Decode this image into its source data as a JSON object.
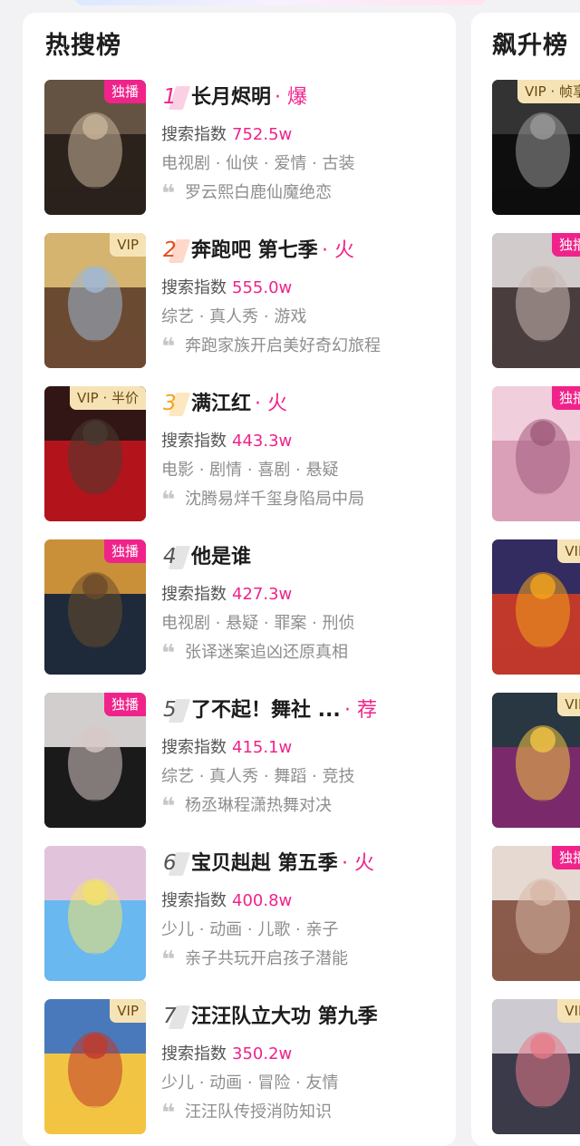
{
  "hot_list": {
    "title": "热搜榜",
    "index_label": "搜索指数",
    "items": [
      {
        "rank": "1",
        "title": "长月烬明",
        "tag": "· 爆",
        "index": "752.5w",
        "genres": "电视剧 · 仙侠 · 爱情 · 古装",
        "quote": "罗云熙白鹿仙魔绝恋",
        "badge": "独播",
        "badge_type": "exclusive",
        "poster_colors": [
          "#6e5a4a",
          "#2b221c",
          "#c8b49a"
        ]
      },
      {
        "rank": "2",
        "title": "奔跑吧 第七季",
        "tag": "· 火",
        "index": "555.0w",
        "genres": "综艺 · 真人秀 · 游戏",
        "quote": "奔跑家族开启美好奇幻旅程",
        "badge": "VIP",
        "badge_type": "vip",
        "poster_colors": [
          "#e8c77a",
          "#6b4a32",
          "#9fb8d4"
        ]
      },
      {
        "rank": "3",
        "title": "满江红",
        "tag": "· 火",
        "index": "443.3w",
        "genres": "电影 · 剧情 · 喜剧 · 悬疑",
        "quote": "沈腾易烊千玺身陷局中局",
        "badge": "VIP · 半价",
        "badge_type": "vip",
        "poster_colors": [
          "#1a1614",
          "#b3141c",
          "#4a3a30"
        ]
      },
      {
        "rank": "4",
        "title": "他是谁",
        "tag": "",
        "index": "427.3w",
        "genres": "电视剧 · 悬疑 · 罪案 · 刑侦",
        "quote": "张译迷案追凶还原真相",
        "badge": "独播",
        "badge_type": "exclusive",
        "poster_colors": [
          "#e8a23a",
          "#1e2a3a",
          "#6a4a2a"
        ]
      },
      {
        "rank": "5",
        "title": "了不起！舞社 ...",
        "tag": "· 荐",
        "index": "415.1w",
        "genres": "综艺 · 真人秀 · 舞蹈 · 竞技",
        "quote": "杨丞琳程潇热舞对决",
        "badge": "独播",
        "badge_type": "exclusive",
        "poster_colors": [
          "#f4efef",
          "#1a1a1a",
          "#d8c8c8"
        ]
      },
      {
        "rank": "6",
        "title": "宝贝赳赳 第五季",
        "tag": "· 火",
        "index": "400.8w",
        "genres": "少儿 · 动画 · 儿歌 · 亲子",
        "quote": "亲子共玩开启孩子潜能",
        "badge": "",
        "badge_type": "none",
        "poster_colors": [
          "#f7c4d8",
          "#6ab8f0",
          "#f2e16a"
        ]
      },
      {
        "rank": "7",
        "title": "汪汪队立大功 第九季",
        "tag": "",
        "index": "350.2w",
        "genres": "少儿 · 动画 · 冒险 · 友情",
        "quote": "汪汪队传授消防知识",
        "badge": "VIP",
        "badge_type": "vip",
        "poster_colors": [
          "#2b6ccf",
          "#f2c443",
          "#c0392b"
        ]
      }
    ]
  },
  "rising_list": {
    "title": "飙升榜",
    "items": [
      {
        "badge": "VIP · 帧享",
        "badge_type": "vip",
        "poster_colors": [
          "#3a3a3a",
          "#0e0e0e",
          "#9a9a9a"
        ]
      },
      {
        "badge": "独播",
        "badge_type": "exclusive",
        "poster_colors": [
          "#e9e4e4",
          "#4a3d3d",
          "#c9b8b4"
        ]
      },
      {
        "badge": "独播",
        "badge_type": "exclusive",
        "poster_colors": [
          "#f4d6e2",
          "#d9a0b8",
          "#a05a7a"
        ]
      },
      {
        "badge": "VIP",
        "badge_type": "vip",
        "poster_colors": [
          "#1a2a6a",
          "#c0392b",
          "#f2a41c"
        ]
      },
      {
        "badge": "VIP",
        "badge_type": "vip",
        "poster_colors": [
          "#1a3a3a",
          "#7a2a6a",
          "#f2c443"
        ]
      },
      {
        "badge": "独播",
        "badge_type": "exclusive",
        "poster_colors": [
          "#f4f0ea",
          "#8a5a4a",
          "#d8b8a8"
        ]
      },
      {
        "badge": "VIP",
        "badge_type": "vip",
        "poster_colors": [
          "#e8e4ea",
          "#3a3a4a",
          "#e67a8a"
        ]
      }
    ]
  },
  "colors": {
    "accent": "#f0238a",
    "exclusive_badge": "#f0238a",
    "vip_badge": "#f6e3b5",
    "vip_text": "#6b4a12"
  }
}
